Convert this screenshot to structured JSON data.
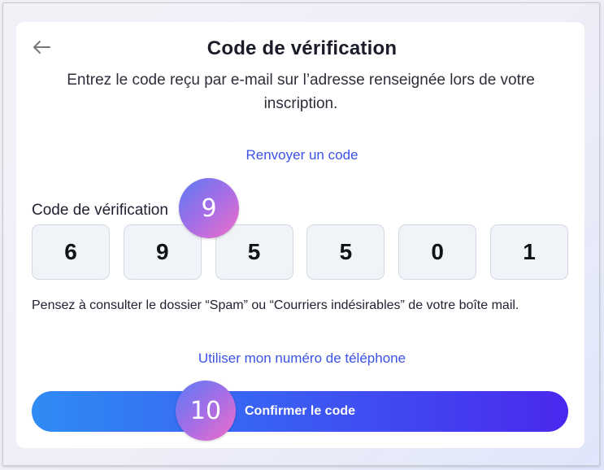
{
  "page": {
    "title": "Code de vérification",
    "subtitle": "Entrez le code reçu par e-mail sur l’adresse renseignée lors de votre inscription.",
    "resend_link": "Renvoyer un code",
    "code_label": "Code de vérification",
    "digits": [
      "6",
      "9",
      "5",
      "5",
      "0",
      "1"
    ],
    "hint": "Pensez à consulter le dossier “Spam” ou “Courriers indésirables” de votre boîte mail.",
    "phone_link": "Utiliser mon numéro de téléphone",
    "confirm_label": "Confirmer le code"
  },
  "markers": {
    "m9": "9",
    "m10": "10"
  },
  "icons": {
    "back": "arrow-left-icon"
  },
  "colors": {
    "link": "#3b52e6",
    "button_start": "#2f8cf5",
    "button_end": "#4a28ee",
    "digit_bg": "#f0f3f8"
  }
}
